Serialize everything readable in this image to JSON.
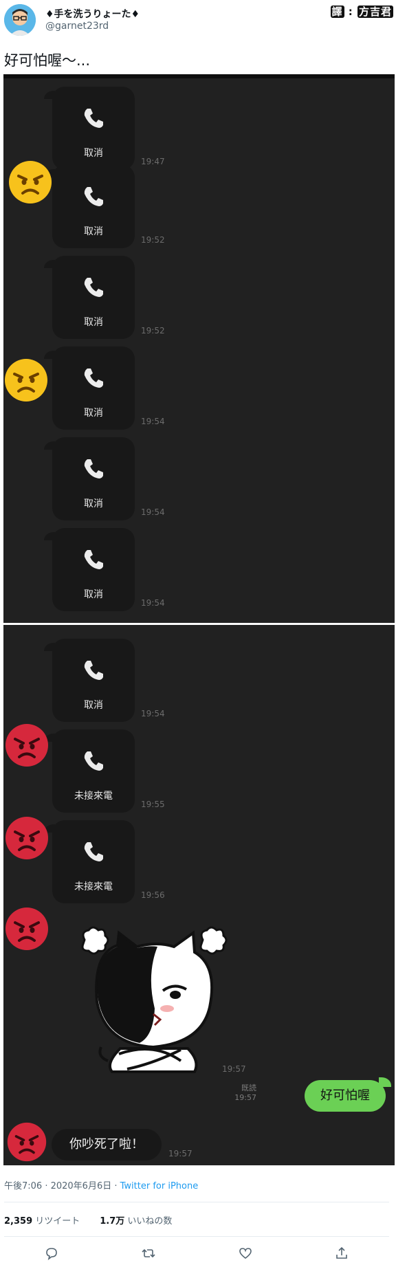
{
  "header": {
    "display_name": "♦手を洗うりょーた♦",
    "handle": "@garnet23rd",
    "credit_prefix": "譯",
    "credit_name": "方吉君"
  },
  "tweet": {
    "text": "好可怕喔～..."
  },
  "chat": {
    "panel1": [
      {
        "label": "取消",
        "time": "19:47"
      },
      {
        "label": "取消",
        "time": "19:52"
      },
      {
        "label": "取消",
        "time": "19:52"
      },
      {
        "label": "取消",
        "time": "19:54"
      },
      {
        "label": "取消",
        "time": "19:54"
      },
      {
        "label": "取消",
        "time": "19:54"
      }
    ],
    "panel2": [
      {
        "label": "取消",
        "time": "19:54"
      },
      {
        "label": "未接來電",
        "time": "19:55"
      },
      {
        "label": "未接來電",
        "time": "19:56"
      }
    ],
    "sticker_time": "19:57",
    "reply": {
      "text": "好可怕喔",
      "read": "既読",
      "time": "19:57"
    },
    "final_msg": {
      "text": "你吵死了啦！",
      "time": "19:57"
    }
  },
  "footer": {
    "time_date": "午後7:06 · 2020年6月6日 · ",
    "source": "Twitter for iPhone",
    "retweets_count": "2,359",
    "retweets_label": "リツイート",
    "likes_count": "1.7万",
    "likes_label": "いいねの数"
  },
  "icons": [
    "reply-icon",
    "retweet-icon",
    "like-icon",
    "share-icon",
    "phone-icon",
    "angry-face-icon"
  ],
  "colors": {
    "accent": "#1d9bf0",
    "reply_green": "#6bd055",
    "chat_bg": "#212121"
  }
}
